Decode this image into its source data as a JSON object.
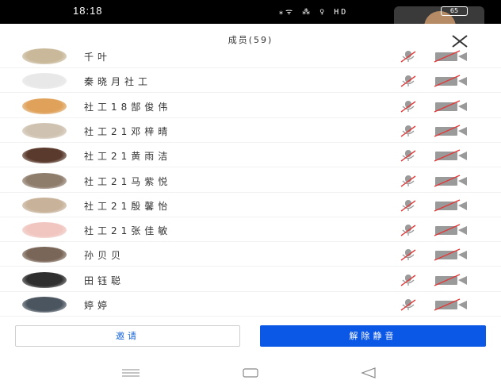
{
  "status_bar": {
    "time": "18:18",
    "icons_text": "⁎ᯤ ⁂ ♀ HD",
    "battery": "65"
  },
  "sheet": {
    "title": "成员(59)"
  },
  "members": [
    {
      "name": "千叶",
      "avatar_color": "#c9b99a"
    },
    {
      "name": "秦晓月社工",
      "avatar_color": "#e8e8e8"
    },
    {
      "name": "社工18郜俊伟",
      "avatar_color": "#e0a25a"
    },
    {
      "name": "社工21邓梓晴",
      "avatar_color": "#cfc2b0"
    },
    {
      "name": "社工21黄雨洁",
      "avatar_color": "#5a3a2c"
    },
    {
      "name": "社工21马紫悦",
      "avatar_color": "#8f7d6c"
    },
    {
      "name": "社工21殷馨怡",
      "avatar_color": "#c8b29a"
    },
    {
      "name": "社工21张佳敏",
      "avatar_color": "#f2c6c0"
    },
    {
      "name": "孙贝贝",
      "avatar_color": "#7a6658"
    },
    {
      "name": "田钰聪",
      "avatar_color": "#2f2f2f"
    },
    {
      "name": "婷婷",
      "avatar_color": "#4a5560"
    }
  ],
  "buttons": {
    "invite": "邀请",
    "unmute_all": "解除静音"
  },
  "colors": {
    "accent": "#0b57e6",
    "muted_red": "#e03a3a",
    "icon_gray": "#9a9a9a"
  }
}
